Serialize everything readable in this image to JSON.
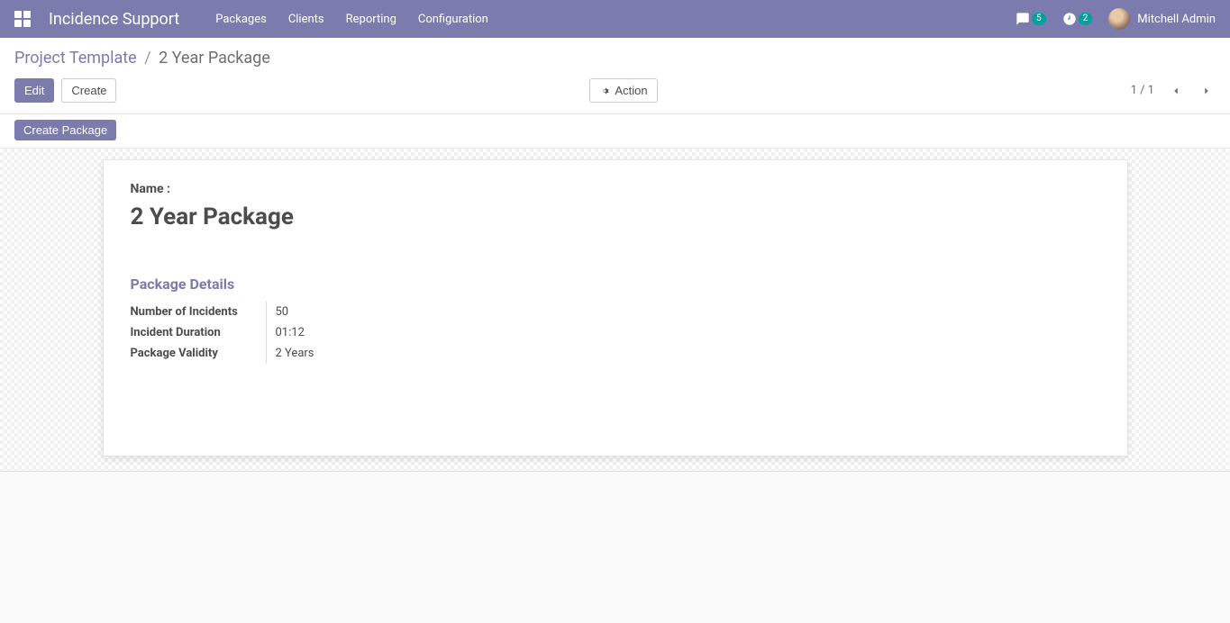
{
  "navbar": {
    "brand": "Incidence Support",
    "menu": [
      "Packages",
      "Clients",
      "Reporting",
      "Configuration"
    ],
    "messages_badge": "5",
    "activities_badge": "2",
    "username": "Mitchell Admin"
  },
  "breadcrumb": {
    "parent": "Project Template",
    "current": "2 Year Package"
  },
  "toolbar": {
    "edit_label": "Edit",
    "create_label": "Create",
    "action_label": "Action",
    "pager": "1 / 1"
  },
  "statusbar": {
    "create_package_label": "Create Package"
  },
  "form": {
    "name_label": "Name :",
    "name_value": "2 Year Package",
    "section_title": "Package Details",
    "rows": [
      {
        "label": "Number of Incidents",
        "value": "50"
      },
      {
        "label": "Incident Duration",
        "value": "01:12"
      },
      {
        "label": "Package Validity",
        "value": "2 Years"
      }
    ]
  }
}
